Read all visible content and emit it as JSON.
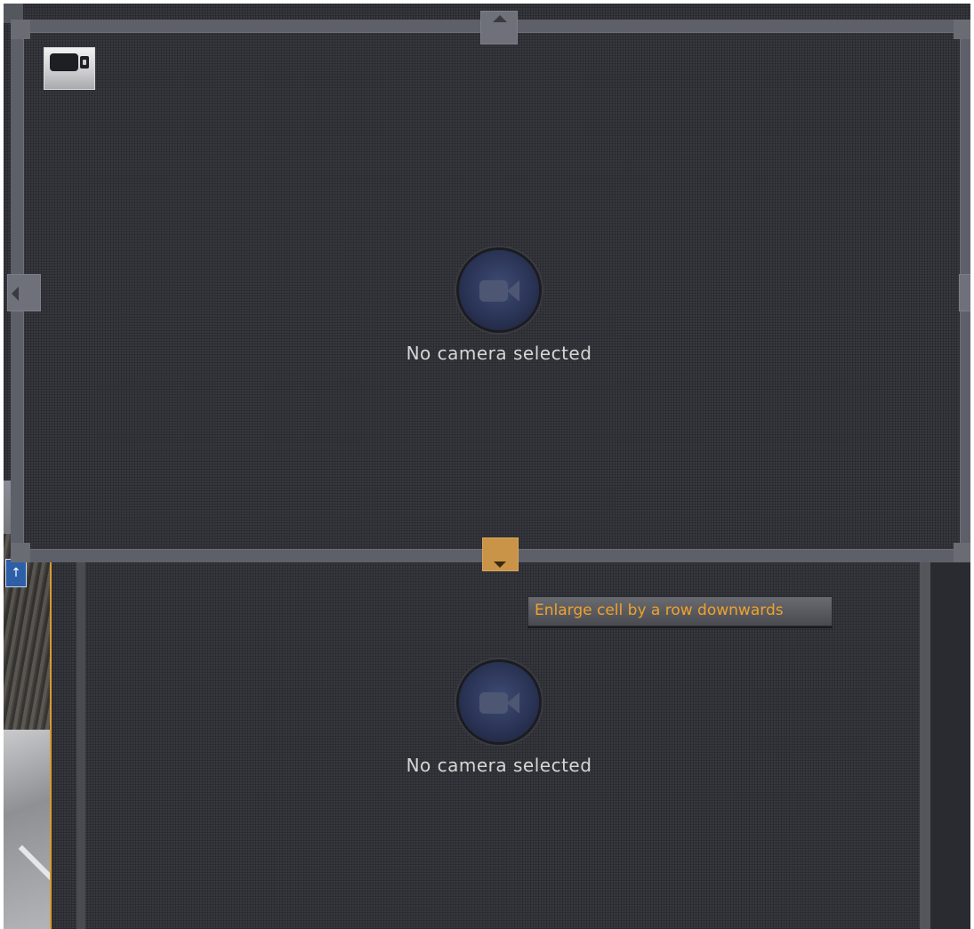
{
  "upper_cell": {
    "placeholder_text": "No camera selected",
    "badge_icon": "video-camera-icon",
    "placeholder_icon": "video-camera-icon"
  },
  "lower_cell": {
    "placeholder_text": "No camera selected",
    "placeholder_icon": "video-camera-icon"
  },
  "tooltip": {
    "text": "Enlarge cell by a row downwards"
  },
  "handles": {
    "top": "arrow-up-icon",
    "left": "arrow-left-icon",
    "right": "arrow-right-icon",
    "bottom": "arrow-down-icon"
  },
  "colors": {
    "accent": "#f0a22a",
    "active_handle": "#c99447",
    "frame": "#5e6069",
    "background": "#2a2b30",
    "placeholder_circle": "#2a3456"
  }
}
